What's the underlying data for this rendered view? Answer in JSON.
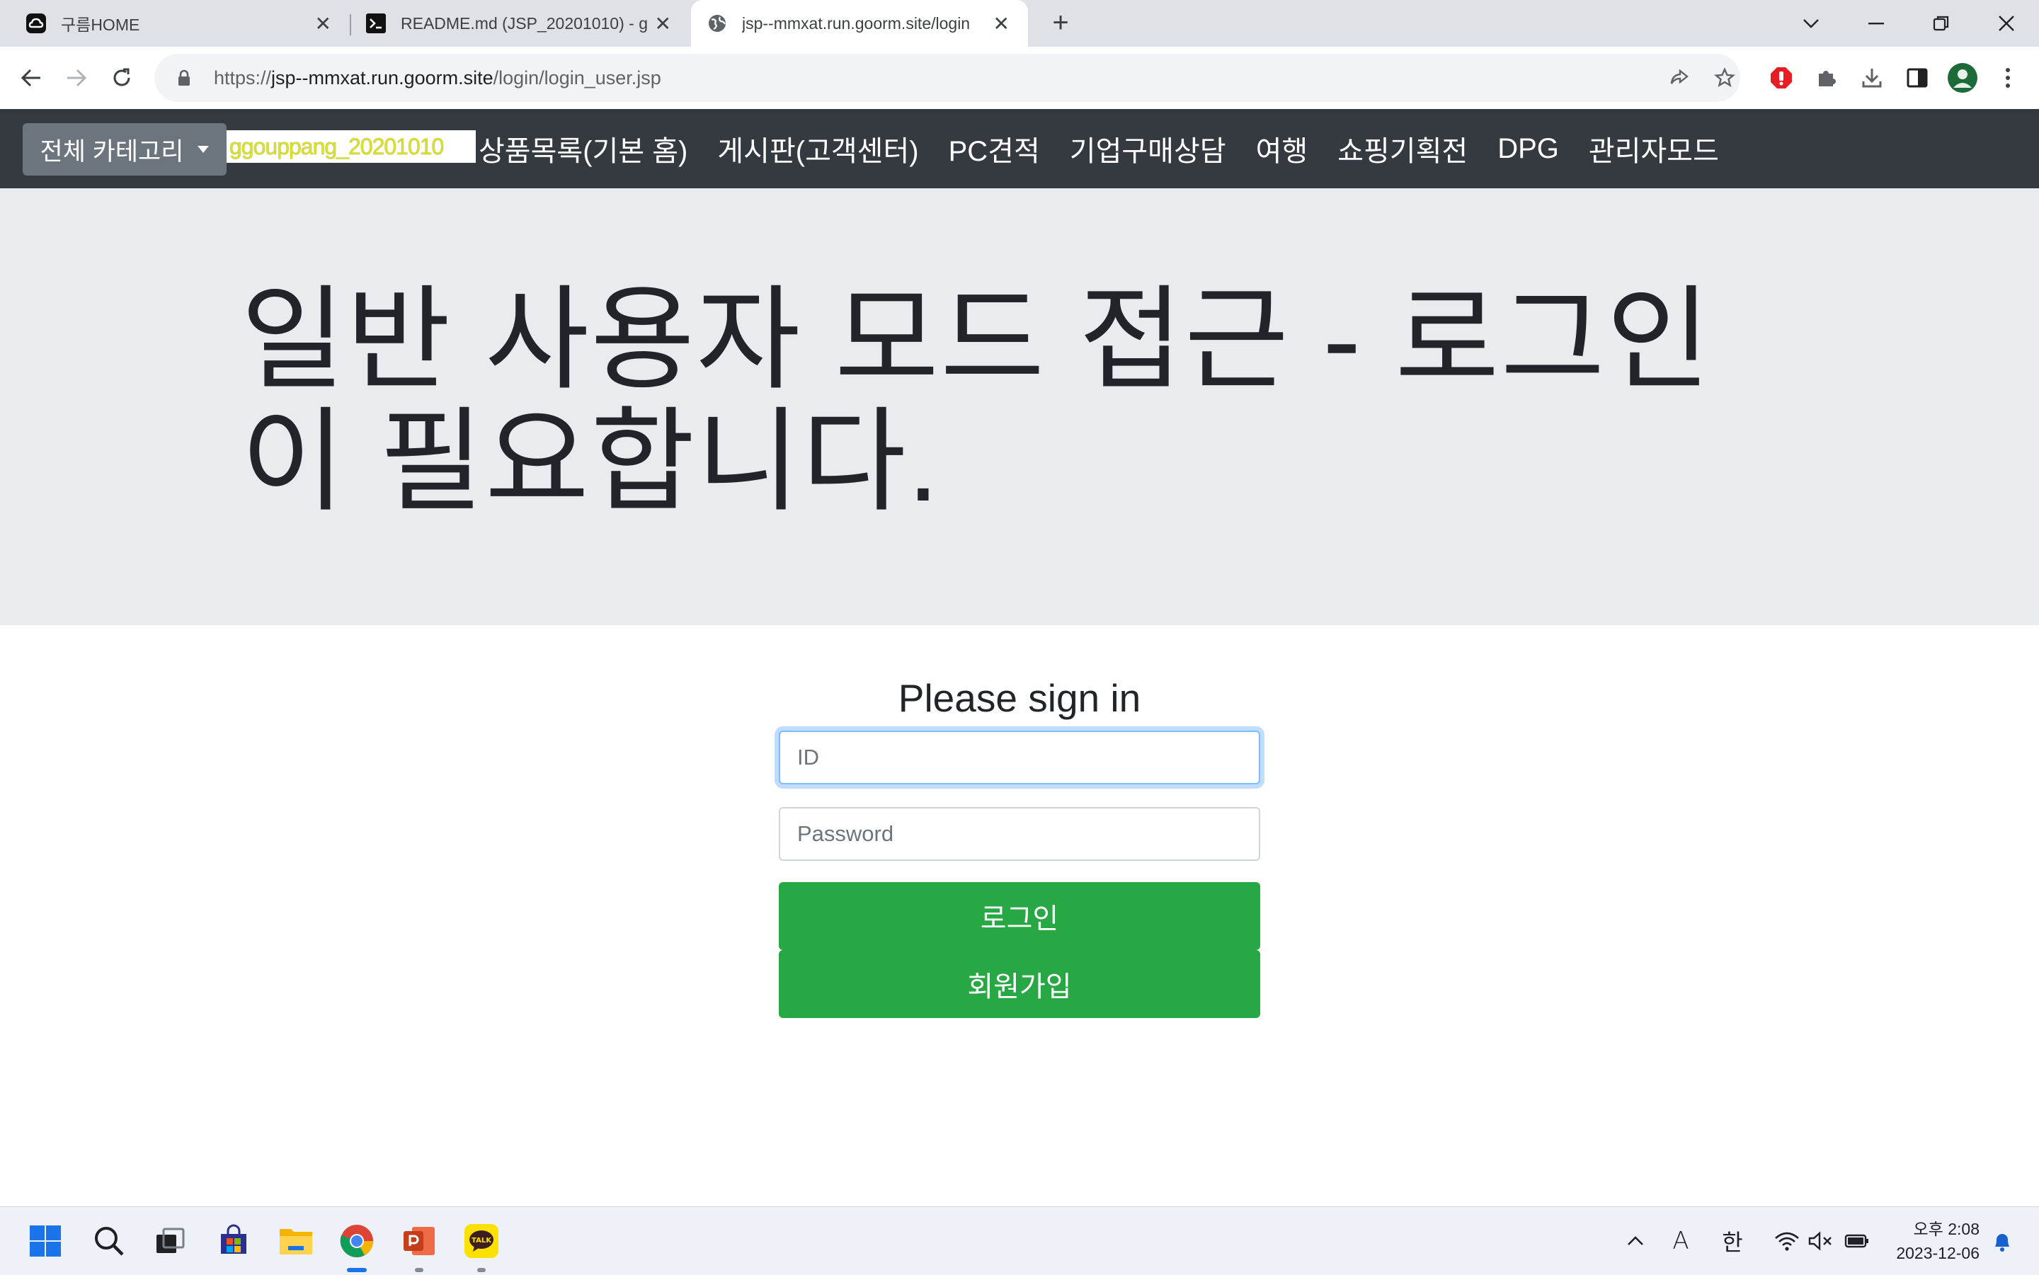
{
  "browser": {
    "tabs": [
      {
        "title": "구름HOME",
        "favicon": "goorm-cloud-icon"
      },
      {
        "title": "README.md (JSP_20201010) - g",
        "favicon": "terminal-icon"
      },
      {
        "title": "jsp--mmxat.run.goorm.site/login",
        "favicon": "globe-icon"
      }
    ],
    "url_prefix": "https://",
    "url_host": "jsp--mmxat.run.goorm.site",
    "url_path": "/login/login_user.jsp"
  },
  "navbar": {
    "category_button": "전체 카테고리",
    "brand": "ggouppang_20201010",
    "links": [
      "상품목록(기본 홈)",
      "게시판(고객센터)",
      "PC견적",
      "기업구매상담",
      "여행",
      "쇼핑기획전",
      "DPG",
      "관리자모드"
    ]
  },
  "jumbotron": {
    "title": "일반 사용자 모드 접근 - 로그인이 필요합니다."
  },
  "signin": {
    "heading": "Please sign in",
    "id_placeholder": "ID",
    "password_placeholder": "Password",
    "login_button": "로그인",
    "register_button": "회원가입"
  },
  "taskbar": {
    "apps": [
      "start-icon",
      "search-icon",
      "task-view-icon",
      "store-icon",
      "file-explorer-icon",
      "chrome-icon",
      "powerpoint-icon",
      "kakaotalk-icon"
    ],
    "tray": {
      "ime_mode": "A",
      "ime_lang": "한"
    },
    "clock_time": "오후 2:08",
    "clock_date": "2023-12-06"
  },
  "colors": {
    "navbar_bg": "#343a40",
    "jumbotron_bg": "#e9ecef",
    "success": "#28a745",
    "secondary": "#6c757d"
  }
}
